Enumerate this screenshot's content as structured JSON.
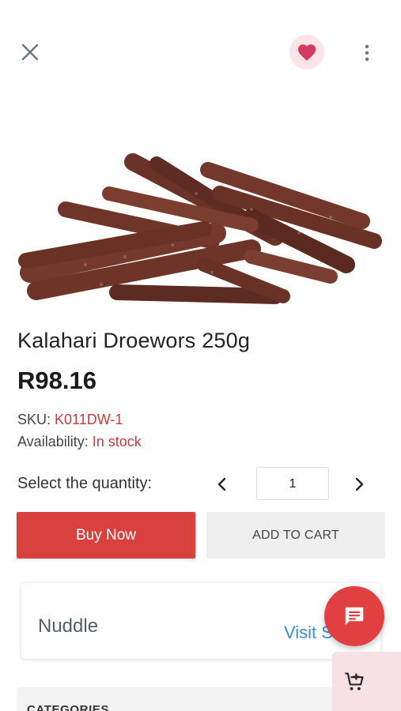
{
  "header": {
    "close_icon": "close-icon",
    "favorite_icon": "heart-icon",
    "more_icon": "more-vertical-icon",
    "favorite_color": "#d23a5f",
    "favorite_bg": "#fbe3e8"
  },
  "product": {
    "title": "Kalahari Droewors 250g",
    "price": "R98.16",
    "sku_label": "SKU:",
    "sku_value": "K011DW-1",
    "availability_label": "Availability:",
    "availability_value": "In stock",
    "image": "dried-sausage-sticks"
  },
  "quantity": {
    "label": "Select the quantity:",
    "value": "1",
    "prev_icon": "chevron-left-icon",
    "next_icon": "chevron-right-icon"
  },
  "actions": {
    "buy_now": "Buy Now",
    "add_to_cart": "ADD TO CART",
    "buy_color": "#d9413f"
  },
  "vendor": {
    "name": "Nuddle",
    "visit_label": "Visit S"
  },
  "categories": {
    "title": "CATEGORIES"
  },
  "fab": {
    "chat_icon": "chat-message-icon",
    "chat_color": "#e0403f",
    "cart_icon": "add-cart-icon"
  }
}
